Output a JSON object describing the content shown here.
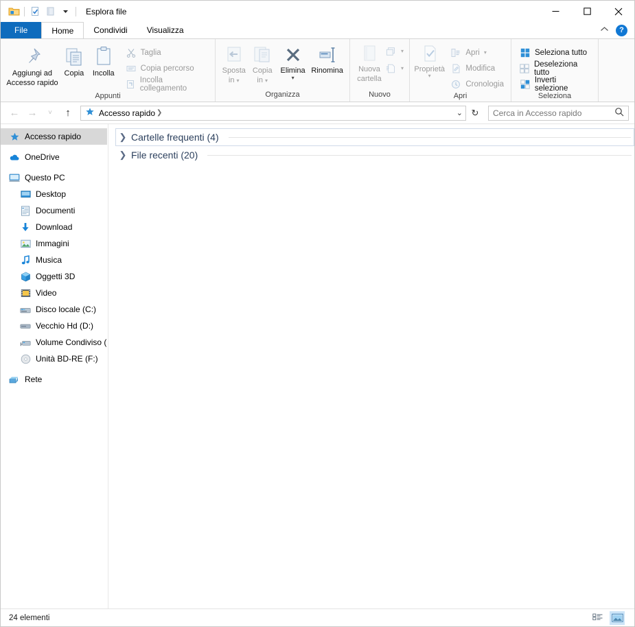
{
  "window": {
    "title": "Esplora file",
    "quick_access_toolbar": [
      {
        "name": "folder-icon",
        "label": "Esplora file"
      },
      {
        "name": "properties-icon",
        "label": "Proprietà"
      },
      {
        "name": "new-folder-icon",
        "label": "Nuova cartella"
      },
      {
        "name": "chevron-down-icon",
        "label": "Personalizza barra di accesso rapido"
      }
    ],
    "controls": {
      "minimize": "─",
      "maximize": "☐",
      "close": "✕"
    }
  },
  "tabs": [
    {
      "id": "file",
      "label": "File"
    },
    {
      "id": "home",
      "label": "Home"
    },
    {
      "id": "condividi",
      "label": "Condividi"
    },
    {
      "id": "visualizza",
      "label": "Visualizza"
    }
  ],
  "tab_tools": {
    "collapse": "˄",
    "help": "?"
  },
  "ribbon": {
    "groups": [
      {
        "title": "Appunti",
        "big_buttons": [
          {
            "label_line1": "Aggiungi ad",
            "label_line2": "Accesso rapido",
            "icon": "pin-icon"
          },
          {
            "label_line1": "Copia",
            "label_line2": "",
            "icon": "copy-icon"
          },
          {
            "label_line1": "Incolla",
            "label_line2": "",
            "icon": "paste-icon"
          }
        ],
        "small_buttons": [
          {
            "label": "Taglia",
            "icon": "scissors-icon",
            "disabled": true
          },
          {
            "label": "Copia percorso",
            "icon": "copy-path-icon",
            "disabled": true
          },
          {
            "label": "Incolla collegamento",
            "icon": "paste-shortcut-icon",
            "disabled": true
          }
        ]
      },
      {
        "title": "Organizza",
        "big_buttons": [
          {
            "label_line1": "Sposta",
            "label_line2": "in",
            "icon": "move-to-icon",
            "dropdown": true,
            "disabled": true
          },
          {
            "label_line1": "Copia",
            "label_line2": "in",
            "icon": "copy-to-icon",
            "dropdown": true,
            "disabled": true
          },
          {
            "label_line1": "Elimina",
            "label_line2": "",
            "icon": "delete-icon",
            "dropdown": true
          },
          {
            "label_line1": "Rinomina",
            "label_line2": "",
            "icon": "rename-icon"
          }
        ],
        "small_buttons": []
      },
      {
        "title": "Nuovo",
        "big_buttons": [
          {
            "label_line1": "Nuova",
            "label_line2": "cartella",
            "icon": "new-folder-icon",
            "disabled": true
          }
        ],
        "small_buttons": [
          {
            "label": "",
            "icon": "new-item-icon",
            "dropdown": true,
            "disabled": true
          },
          {
            "label": "",
            "icon": "easy-access-icon",
            "dropdown": true,
            "disabled": true
          }
        ]
      },
      {
        "title": "Apri",
        "big_buttons": [
          {
            "label_line1": "Proprietà",
            "label_line2": "",
            "icon": "properties-icon",
            "dropdown": true,
            "disabled": true
          }
        ],
        "small_buttons": [
          {
            "label": "Apri",
            "icon": "open-icon",
            "dropdown": true,
            "disabled": true
          },
          {
            "label": "Modifica",
            "icon": "edit-icon",
            "disabled": true
          },
          {
            "label": "Cronologia",
            "icon": "history-icon",
            "disabled": true
          }
        ]
      },
      {
        "title": "Seleziona",
        "big_buttons": [],
        "small_buttons": [
          {
            "label": "Seleziona tutto",
            "icon": "select-all-icon",
            "disabled": false
          },
          {
            "label": "Deseleziona tutto",
            "icon": "select-none-icon",
            "disabled": false
          },
          {
            "label": "Inverti selezione",
            "icon": "invert-selection-icon",
            "disabled": false
          }
        ]
      }
    ]
  },
  "address": {
    "back": "←",
    "forward": "→",
    "recent": "˅",
    "up": "↑",
    "breadcrumb_icon": "quick-access-star-icon",
    "breadcrumb": [
      "Accesso rapido"
    ],
    "dropdown": "˅",
    "refresh": "↻"
  },
  "search": {
    "placeholder": "Cerca in Accesso rapido",
    "value": "",
    "icon": "search-icon"
  },
  "sidebar": {
    "items": [
      {
        "label": "Accesso rapido",
        "icon": "star-icon",
        "indent": false,
        "selected": true
      },
      {
        "gap": true
      },
      {
        "label": "OneDrive",
        "icon": "cloud-icon",
        "indent": false,
        "selected": false
      },
      {
        "gap": true
      },
      {
        "label": "Questo PC",
        "icon": "monitor-icon",
        "indent": false,
        "selected": false
      },
      {
        "label": "Desktop",
        "icon": "desktop-icon",
        "indent": true,
        "selected": false
      },
      {
        "label": "Documenti",
        "icon": "documents-icon",
        "indent": true,
        "selected": false
      },
      {
        "label": "Download",
        "icon": "download-icon",
        "indent": true,
        "selected": false
      },
      {
        "label": "Immagini",
        "icon": "pictures-icon",
        "indent": true,
        "selected": false
      },
      {
        "label": "Musica",
        "icon": "music-icon",
        "indent": true,
        "selected": false
      },
      {
        "label": "Oggetti 3D",
        "icon": "3d-objects-icon",
        "indent": true,
        "selected": false
      },
      {
        "label": "Video",
        "icon": "video-icon",
        "indent": true,
        "selected": false
      },
      {
        "label": "Disco locale (C:)",
        "icon": "harddrive-icon",
        "indent": true,
        "selected": false
      },
      {
        "label": "Vecchio Hd (D:)",
        "icon": "drive-icon",
        "indent": true,
        "selected": false
      },
      {
        "label": "Volume Condiviso (",
        "icon": "network-drive-icon",
        "indent": true,
        "selected": false
      },
      {
        "label": "Unità BD-RE (F:)",
        "icon": "optical-drive-icon",
        "indent": true,
        "selected": false
      },
      {
        "gap": true
      },
      {
        "label": "Rete",
        "icon": "network-icon",
        "indent": false,
        "selected": false
      }
    ]
  },
  "content": {
    "groups": [
      {
        "label": "Cartelle frequenti (4)",
        "expanded": false,
        "focused": true
      },
      {
        "label": "File recenti (20)",
        "expanded": false,
        "focused": false
      }
    ]
  },
  "statusbar": {
    "item_count": "24 elementi",
    "views": [
      {
        "name": "details-view-button",
        "active": false
      },
      {
        "name": "large-icons-view-button",
        "active": true
      }
    ]
  },
  "colors": {
    "accent": "#0f6cbd",
    "file_tab": "#0f6cbd",
    "sidebar_selection": "#d8d8d8",
    "group_label": "#2b3f5c",
    "ribbon_bg": "#fafafa",
    "help_blue": "#1178d4"
  }
}
